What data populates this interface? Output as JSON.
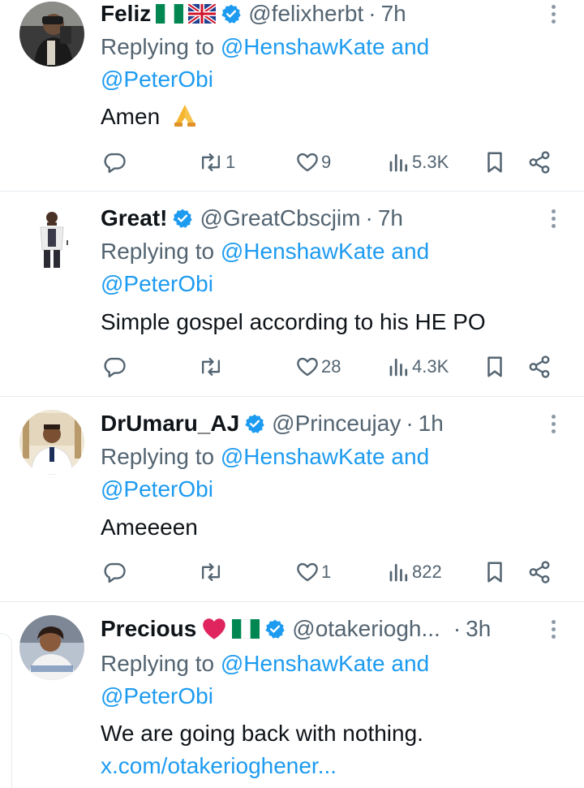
{
  "tweets": [
    {
      "name": "Feliz",
      "handle": "@felixherbt",
      "sep": "·",
      "time": "7h",
      "replying_prefix": "Replying to ",
      "mention1": "@HenshawKate",
      "and": " and",
      "mention2": "@PeterObi",
      "text": "Amen",
      "text_emoji": "folded-hands",
      "name_emoji": [
        "nigeria-flag",
        "uk-flag"
      ],
      "stats": {
        "replies": "",
        "reposts": "1",
        "likes": "9",
        "views": "5.3K"
      }
    },
    {
      "name": "Great!",
      "handle": "@GreatCbscjim",
      "sep": "·",
      "time": "7h",
      "replying_prefix": "Replying to ",
      "mention1": "@HenshawKate",
      "and": " and",
      "mention2": "@PeterObi",
      "text": "Simple gospel according to his HE PO",
      "stats": {
        "replies": "",
        "reposts": "",
        "likes": "28",
        "views": "4.3K"
      }
    },
    {
      "name": "DrUmaru_AJ",
      "handle": "@Princeujay",
      "sep": "·",
      "time": "1h",
      "replying_prefix": "Replying to ",
      "mention1": "@HenshawKate",
      "and": " and",
      "mention2": "@PeterObi",
      "text": "Ameeeen",
      "stats": {
        "replies": "",
        "reposts": "",
        "likes": "1",
        "views": "822"
      }
    },
    {
      "name": "Precious",
      "handle": "@otakeriogh...",
      "sep": "·",
      "time": "3h",
      "replying_prefix": "Replying to ",
      "mention1": "@HenshawKate",
      "and": " and",
      "mention2": "@PeterObi",
      "text": "We are going back with nothing.",
      "link": "x.com/otakerioghener...",
      "name_emoji": [
        "red-heart",
        "nigeria-flag"
      ]
    }
  ],
  "colors": {
    "link": "#1d9bf0",
    "secondary": "#536471",
    "verified": "#1d9bf0",
    "heart": "#e0245e",
    "nigeria_green": "#008751"
  }
}
